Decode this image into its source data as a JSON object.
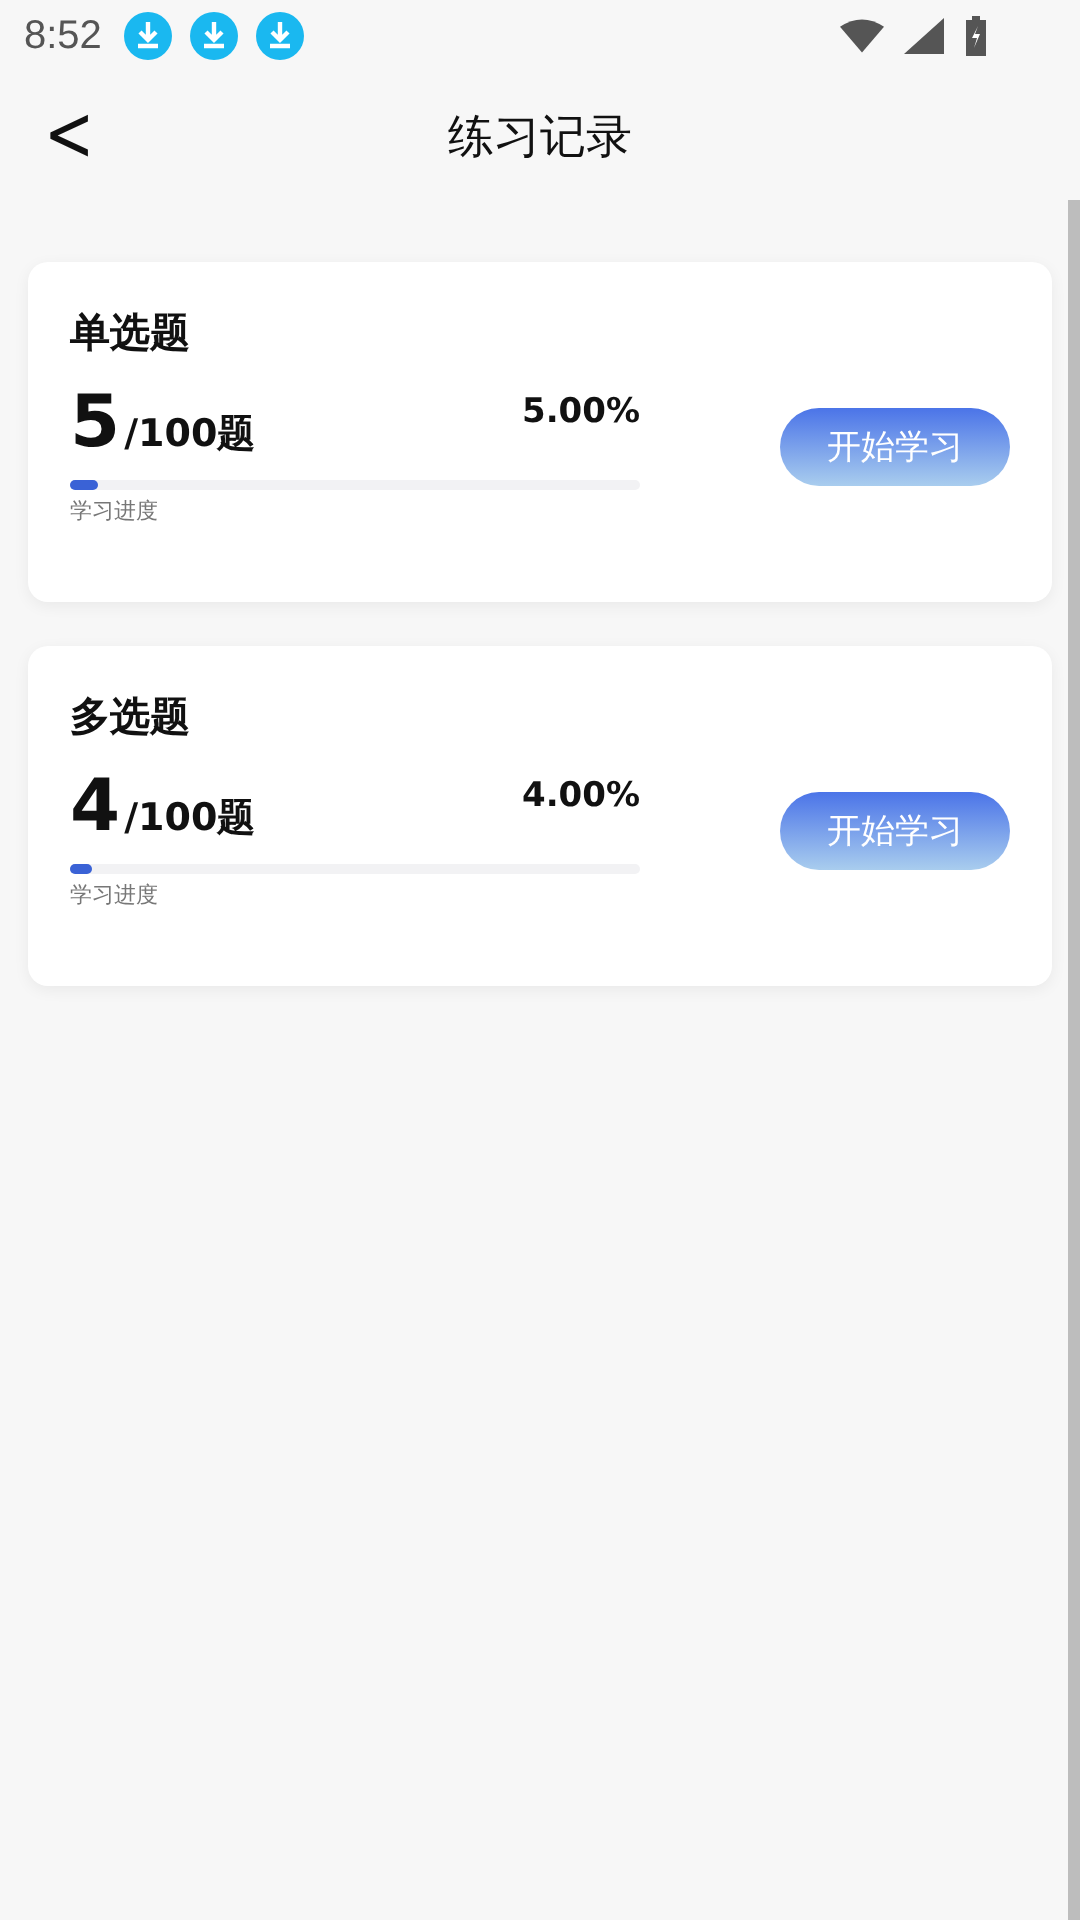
{
  "status_bar": {
    "time": "8:52",
    "notifications": [
      {
        "kind": "download"
      },
      {
        "kind": "download"
      },
      {
        "kind": "download"
      }
    ]
  },
  "header": {
    "back": "<",
    "title": "练习记录"
  },
  "records": [
    {
      "title": "单选题",
      "count": "5",
      "total": "/100题",
      "percent": "5.00%",
      "level": 0.05,
      "progress_label": "学习进度",
      "button": "开始学习"
    },
    {
      "title": "多选题",
      "count": "4",
      "total": "/100题",
      "percent": "4.00%",
      "level": 0.04,
      "progress_label": "学习进度",
      "button": "开始学习"
    }
  ]
}
